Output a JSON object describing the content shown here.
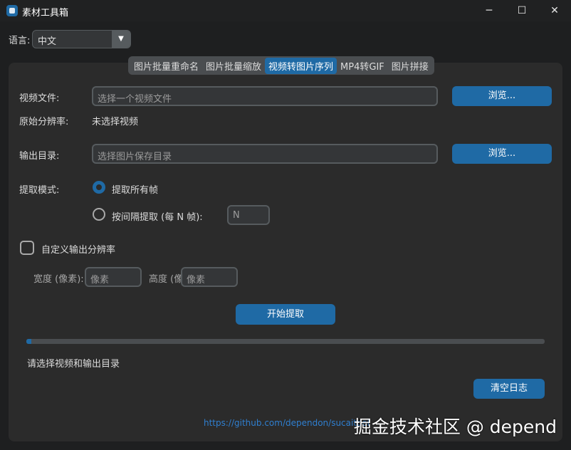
{
  "window": {
    "title": "素材工具箱",
    "minimize": "─",
    "maximize": "☐",
    "close": "✕"
  },
  "language": {
    "label": "语言:",
    "value": "中文"
  },
  "tabs": [
    {
      "label": "图片批量重命名",
      "active": false
    },
    {
      "label": "图片批量缩放",
      "active": false
    },
    {
      "label": "视频转图片序列",
      "active": true
    },
    {
      "label": "MP4转GIF",
      "active": false
    },
    {
      "label": "图片拼接",
      "active": false
    }
  ],
  "video": {
    "label": "视频文件:",
    "placeholder": "选择一个视频文件",
    "browse": "浏览..."
  },
  "resolution": {
    "label": "原始分辨率:",
    "value": "未选择视频"
  },
  "output": {
    "label": "输出目录:",
    "placeholder": "选择图片保存目录",
    "browse": "浏览..."
  },
  "mode": {
    "label": "提取模式:",
    "all_frames": "提取所有帧",
    "interval": "按间隔提取 (每 N 帧):",
    "interval_placeholder": "N",
    "selected": "all_frames"
  },
  "custom": {
    "label": "自定义输出分辨率",
    "checked": false,
    "width_label": "宽度 (像素):",
    "width_placeholder": "像素",
    "height_label": "高度 (像",
    "height_placeholder": "像素"
  },
  "start_button": "开始提取",
  "progress": {
    "value": 0.01
  },
  "status": "请选择视频和输出目录",
  "clear_log": "清空日志",
  "link": "https://github.com/dependon/sucaitool",
  "watermark": "掘金技术社区 @ depend"
}
